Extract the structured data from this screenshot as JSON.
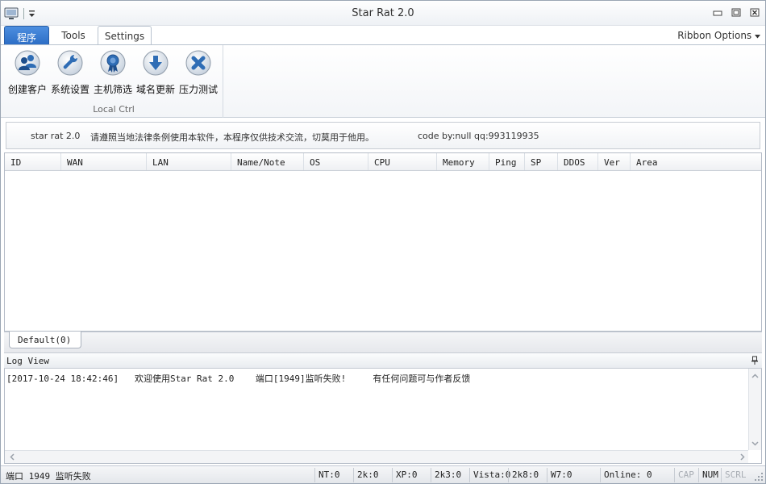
{
  "window": {
    "title": "Star Rat 2.0"
  },
  "ribbon": {
    "tabs": [
      {
        "label": "程序"
      },
      {
        "label": "Tools"
      },
      {
        "label": "Settings"
      }
    ],
    "options_label": "Ribbon Options",
    "group_label": "Local Ctrl",
    "buttons": [
      {
        "label": "创建客户",
        "icon": "users-icon"
      },
      {
        "label": "系统设置",
        "icon": "wrench-icon"
      },
      {
        "label": "主机筛选",
        "icon": "award-icon"
      },
      {
        "label": "域名更新",
        "icon": "download-icon"
      },
      {
        "label": "压力测试",
        "icon": "close-x-icon"
      }
    ]
  },
  "infobar": {
    "version": "star rat 2.0",
    "notice": "请遵照当地法律条例使用本软件，本程序仅供技术交流，切莫用于他用。",
    "author": "code by:null qq:993119935"
  },
  "list": {
    "columns": [
      "ID",
      "WAN",
      "LAN",
      "Name/Note",
      "OS",
      "CPU",
      "Memory",
      "Ping",
      "SP",
      "DDOS",
      "Ver",
      "Area"
    ],
    "rows": []
  },
  "list_tabs": [
    {
      "label": "Default(0)"
    }
  ],
  "log": {
    "title": "Log View",
    "line": "[2017-10-24 18:42:46]   欢迎使用Star Rat 2.0    端口[1949]监听失败!     有任何问题可与作者反馈"
  },
  "status": {
    "message": "端口 1949 监听失败",
    "nt": "NT:0",
    "k2": "2k:0",
    "xp": "XP:0",
    "k3": "2k3:0",
    "vista": "Vista:0",
    "k8": "2k8:0",
    "w7": "W7:0",
    "online": "Online: 0",
    "cap": "CAP",
    "num": "NUM",
    "scrl": "SCRL"
  },
  "colors": {
    "accent": "#2b6cc4",
    "icon_blue": "#2f6db5"
  }
}
